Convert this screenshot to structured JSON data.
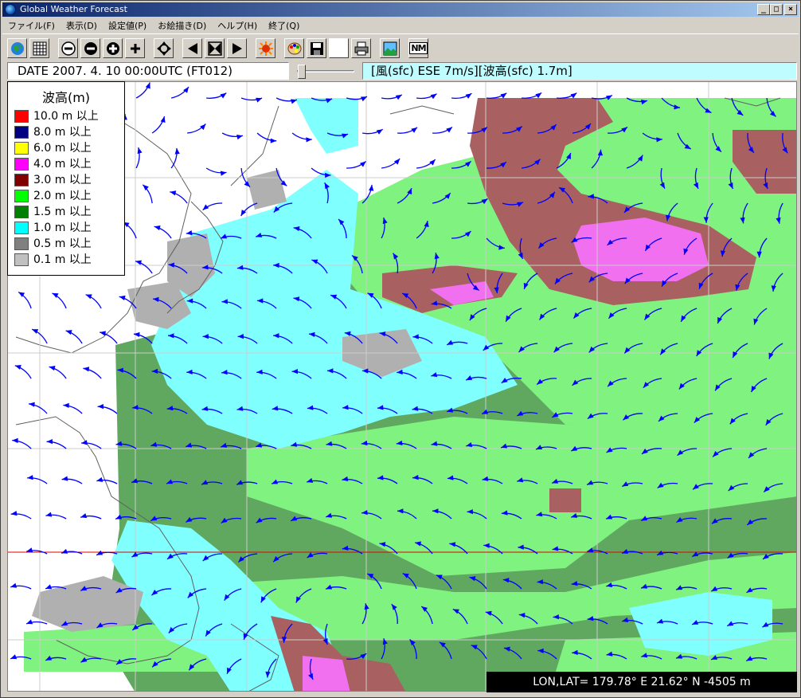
{
  "window": {
    "title": "Global Weather Forecast",
    "minimize_glyph": "_",
    "maximize_glyph": "□",
    "close_glyph": "×"
  },
  "menu": [
    {
      "label": "ファイル(F)"
    },
    {
      "label": "表示(D)"
    },
    {
      "label": "設定値(P)"
    },
    {
      "label": "お絵描き(D)"
    },
    {
      "label": "ヘルプ(H)"
    },
    {
      "label": "終了(Q)"
    }
  ],
  "toolbar": {
    "icons": [
      "globe-icon",
      "grid-icon",
      "minus-icon",
      "zoom-out-icon",
      "zoom-in-icon",
      "plus-icon",
      "move-icon",
      "prev-icon",
      "fit-icon",
      "next-icon",
      "sun-icon",
      "palette-icon",
      "save-icon",
      "blank-icon",
      "print-icon",
      "image-icon",
      "nm-icon"
    ],
    "nm_label": "NM"
  },
  "status": {
    "date_text": "DATE 2007. 4. 10 00:00UTC (FT012)",
    "info_text": "[風(sfc) ESE 7m/s][波高(sfc) 1.7m]",
    "slider_fraction": 0.05
  },
  "legend": {
    "title": "波高(m)",
    "entries": [
      {
        "label": "10.0 m 以上",
        "color": "#ff0000"
      },
      {
        "label": "8.0 m 以上",
        "color": "#000080"
      },
      {
        "label": "6.0 m 以上",
        "color": "#ffff00"
      },
      {
        "label": "4.0 m 以上",
        "color": "#ff00ff"
      },
      {
        "label": "3.0 m 以上",
        "color": "#800000"
      },
      {
        "label": "2.0 m 以上",
        "color": "#00ff00"
      },
      {
        "label": "1.5 m 以上",
        "color": "#008000"
      },
      {
        "label": "1.0 m 以上",
        "color": "#00ffff"
      },
      {
        "label": "0.5 m 以上",
        "color": "#808080"
      },
      {
        "label": "0.1 m 以上",
        "color": "#c0c0c0"
      }
    ]
  },
  "coordinates": {
    "text": "LON,LAT= 179.78° E   21.62° N   -4505 m"
  },
  "colors": {
    "wind_arrow": "#0000ff",
    "map_lightgreen": "#7ff27f",
    "map_green": "#60a860",
    "map_cyan": "#80ffff",
    "map_gray": "#b0b0b0",
    "map_maroon": "#a86060",
    "map_magenta": "#f070f0",
    "equator_line": "#e00000"
  }
}
